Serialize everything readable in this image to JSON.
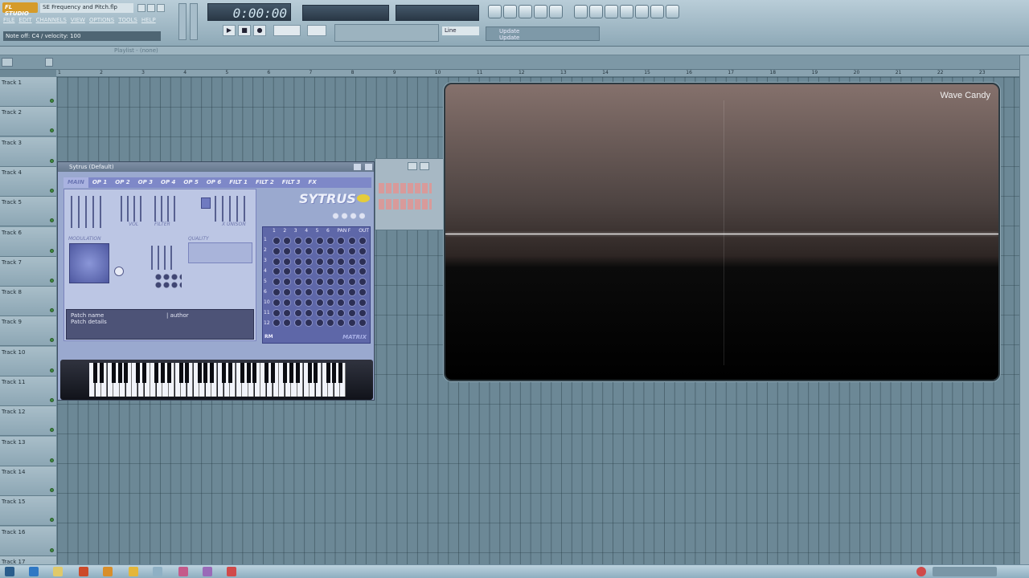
{
  "app": {
    "logo": "FL STUDIO",
    "file_title": "SE Frequency and Pitch.flp",
    "menu": [
      "FILE",
      "EDIT",
      "CHANNELS",
      "VIEW",
      "OPTIONS",
      "TOOLS",
      "HELP"
    ],
    "hint": "Note off: C4 / velocity: 100"
  },
  "transport": {
    "time": "0:00:00",
    "line_mode": "Line",
    "news_line1": "Update",
    "news_line2": "Update"
  },
  "playlist": {
    "title": "Playlist - (none)",
    "ruler": [
      "1",
      "2",
      "3",
      "4",
      "5",
      "6",
      "7",
      "8",
      "9",
      "10",
      "11",
      "12",
      "13",
      "14",
      "15",
      "16",
      "17",
      "18",
      "19",
      "20",
      "21",
      "22",
      "23"
    ],
    "tracks": [
      "Track 1",
      "Track 2",
      "Track 3",
      "Track 4",
      "Track 5",
      "Track 6",
      "Track 7",
      "Track 8",
      "Track 9",
      "Track 10",
      "Track 11",
      "Track 12",
      "Track 13",
      "Track 14",
      "Track 15",
      "Track 16",
      "Track 17"
    ]
  },
  "wave_candy": {
    "title": "Wave Candy"
  },
  "sytrus": {
    "title": "Sytrus (Default)",
    "tabs": [
      "MAIN",
      "OP 1",
      "OP 2",
      "OP 3",
      "OP 4",
      "OP 5",
      "OP 6",
      "FILT 1",
      "FILT 2",
      "FILT 3",
      "FX"
    ],
    "active_tab": "MAIN",
    "logo": "SYTRUS",
    "labels": {
      "vol": "VOL",
      "filter": "FILTER",
      "unison": "X UNISON",
      "modulation": "MODULATION",
      "quality": "QUALITY",
      "matrix": "MATRIX",
      "rm": "RM"
    },
    "matrix_cols": [
      "1",
      "2",
      "3",
      "4",
      "5",
      "6",
      "PAN",
      "F",
      "OUT"
    ],
    "matrix_rows": [
      "1",
      "2",
      "3",
      "4",
      "5",
      "6",
      "10",
      "11",
      "12"
    ],
    "patch_name": "Patch name",
    "patch_author": "| author",
    "patch_details": "Patch details"
  },
  "colors": {
    "accent": "#d59b2a",
    "grid": "#6c8896",
    "sytrus_bg": "#9aa9cf",
    "wave_line": "#ffffff"
  }
}
